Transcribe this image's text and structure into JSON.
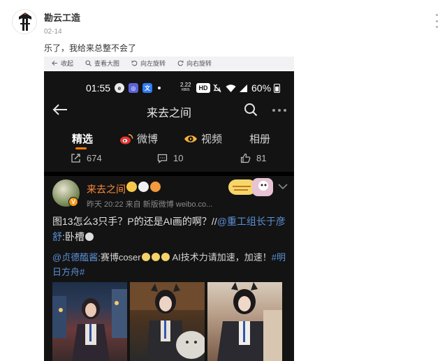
{
  "post": {
    "author": "勘云工造",
    "date": "02-14",
    "text": "乐了，我给来总整不会了"
  },
  "toolbar": {
    "collapse": "收起",
    "view_large": "查看大图",
    "rotate_left": "向左旋转",
    "rotate_right": "向右旋转"
  },
  "screenshot": {
    "status": {
      "time": "01:55",
      "speed_value": "2.22",
      "speed_unit": "KB/S",
      "hd": "HD",
      "battery": "60%"
    },
    "nav": {
      "title": "来去之间"
    },
    "tabs": [
      {
        "label": "精选"
      },
      {
        "label": "微博"
      },
      {
        "label": "视频"
      },
      {
        "label": "相册"
      }
    ],
    "stats": {
      "reposts": "674",
      "comments": "10",
      "likes": "81"
    },
    "inner_post": {
      "name": "来去之间",
      "vip": "V",
      "meta": "昨天 20:22  来自 新版微博 weibo.co...",
      "text_a": "图13怎么3只手？P的还是AI画的啊？//",
      "mention_a": "@重工组长于彦",
      "mention_a2": "舒",
      "text_b": ":卧槽",
      "mention_b": "@贞德醢酱",
      "text_c": ":赛博coser",
      "text_d": " AI技术力请加速，加速！",
      "topic_a": "#明",
      "topic_b": "日方舟#"
    },
    "icons": [
      "back-arrow",
      "search",
      "more",
      "weibo",
      "video",
      "repost",
      "comment",
      "like"
    ]
  }
}
